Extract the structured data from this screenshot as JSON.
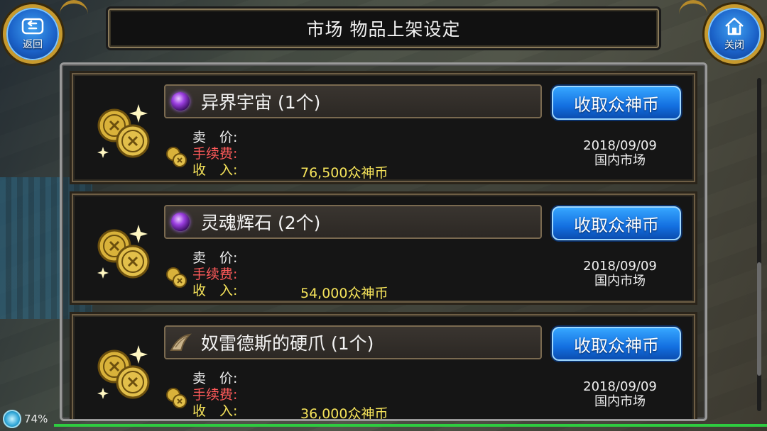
{
  "header": {
    "title": "市场 物品上架设定",
    "back_label": "返回",
    "close_label": "关闭"
  },
  "listings": [
    {
      "item_name": "异界宇宙 (1个)",
      "icon": "purple-orb-icon",
      "claim_label": "收取众神币",
      "price_label": "卖　价:",
      "fee_label": "手续费:",
      "income_label": "收　入:",
      "income_value": "76,500众神币",
      "date": "2018/09/09",
      "market": "国内市场"
    },
    {
      "item_name": "灵魂辉石 (2个)",
      "icon": "purple-orb-icon",
      "claim_label": "收取众神币",
      "price_label": "卖　价:",
      "fee_label": "手续费:",
      "income_label": "收　入:",
      "income_value": "54,000众神币",
      "date": "2018/09/09",
      "market": "国内市场"
    },
    {
      "item_name": "奴雷德斯的硬爪 (1个)",
      "icon": "claw-icon",
      "claim_label": "收取众神币",
      "price_label": "卖　价:",
      "fee_label": "手续费:",
      "income_label": "收　入:",
      "income_value": "36,000众神币",
      "date": "2018/09/09",
      "market": "国内市场"
    }
  ],
  "status": {
    "battery": "74%"
  },
  "colors": {
    "button_blue": "#136fe0",
    "fee_red": "#ff5a5a",
    "income_yellow": "#f5e35a",
    "frame_gold": "#c79a2e"
  }
}
